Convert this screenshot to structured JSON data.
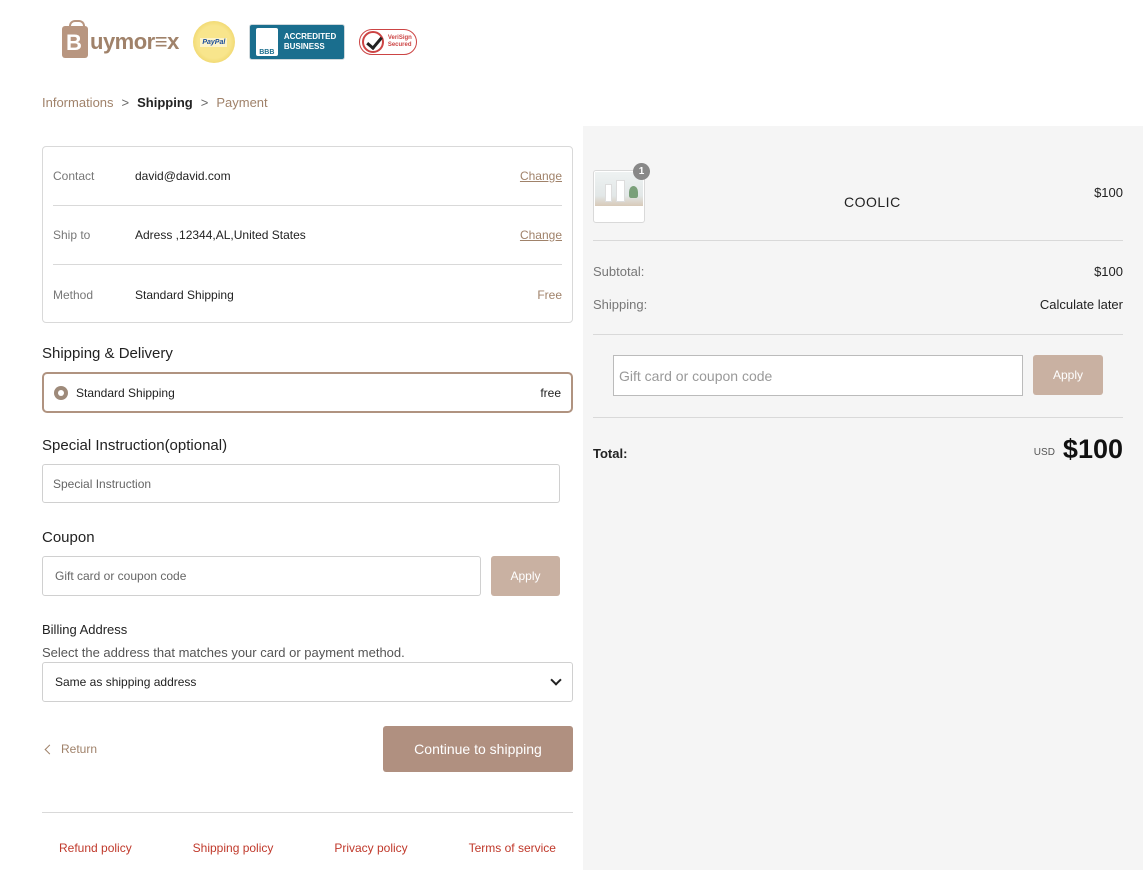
{
  "header": {
    "brand": "uymor≡x",
    "brand_initial": "B",
    "paypal_seal": "PayPal",
    "bbb_mark": "BBB",
    "bbb_text_1": "ACCREDITED",
    "bbb_text_2": "BUSINESS",
    "verisign_text_1": "VeriSign",
    "verisign_text_2": "Secured"
  },
  "breadcrumb": {
    "step1": "Informations",
    "step2": "Shipping",
    "step3": "Payment",
    "separator": ">"
  },
  "review": {
    "contact_label": "Contact",
    "contact_value": "david@david.com",
    "contact_action": "Change",
    "shipto_label": "Ship to",
    "shipto_value": "Adress ,12344,AL,United States",
    "shipto_action": "Change",
    "method_label": "Method",
    "method_value": "Standard Shipping",
    "method_price": "Free"
  },
  "shipping_delivery": {
    "title": "Shipping & Delivery",
    "option_label": "Standard Shipping",
    "option_price": "free"
  },
  "special_instruction": {
    "title": "Special Instruction(optional)",
    "placeholder": "Special Instruction"
  },
  "coupon": {
    "title": "Coupon",
    "placeholder": "Gift card or coupon code",
    "apply_label": "Apply"
  },
  "billing": {
    "title": "Billing Address",
    "subtitle": "Select the address that matches your card or payment method.",
    "selected": "Same as shipping address"
  },
  "actions": {
    "return_label": "Return",
    "continue_label": "Continue to shipping"
  },
  "footer": {
    "refund": "Refund policy",
    "shipping": "Shipping policy",
    "privacy": "Privacy policy",
    "terms": "Terms of service"
  },
  "summary": {
    "item_name": "COOLIC",
    "item_qty": "1",
    "item_price": "$100",
    "subtotal_label": "Subtotal:",
    "subtotal_value": "$100",
    "shipping_label": "Shipping:",
    "shipping_value": "Calculate later",
    "gift_placeholder": "Gift card or coupon code",
    "apply_label": "Apply",
    "total_label": "Total:",
    "currency": "USD",
    "total_value": "$100"
  },
  "colors": {
    "accent": "#b09080",
    "accent_light": "#c9b1a2",
    "link": "#a0826a",
    "footer_link": "#c0392b",
    "summary_bg": "#f5f5f5"
  }
}
